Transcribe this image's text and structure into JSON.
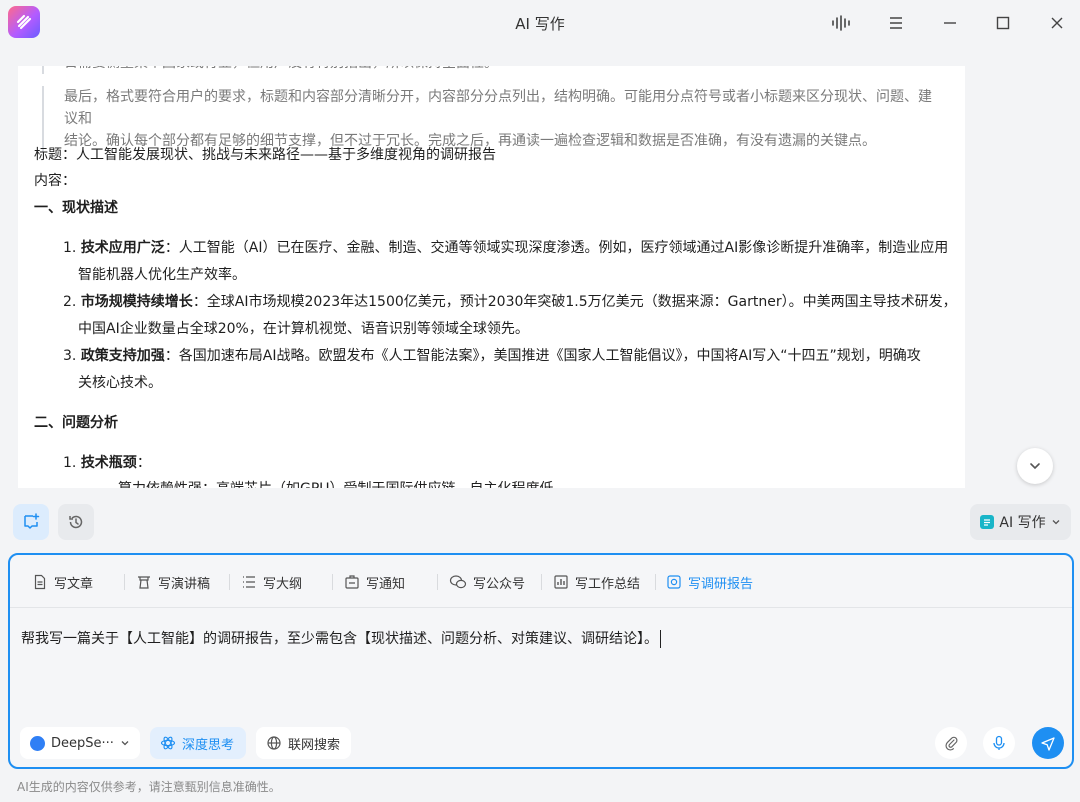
{
  "app": {
    "title": "AI 写作"
  },
  "doc": {
    "quote_partial": "日需要侧重某个国家或行业，但用户没有特别指出，所以保持全面性。",
    "quote_line1": "最后，格式要符合用户的要求，标题和内容部分清晰分开，内容部分分点列出，结构明确。可能用分点符号或者小标题来区分现状、问题、建议和",
    "quote_line2": "结论。确认每个部分都有足够的细节支撑，但不过于冗长。完成之后，再通读一遍检查逻辑和数据是否准确，有没有遗漏的关键点。",
    "title_line": "标题：人工智能发展现状、挑战与未来路径——基于多维度视角的调研报告",
    "content_label": "内容：",
    "section1": "一、现状描述",
    "items": [
      {
        "num": "1.",
        "bold": "技术应用广泛",
        "text1": "：人工智能（AI）已在医疗、金融、制造、交通等领域实现深度渗透。例如，医疗领域通过AI影像诊断提升准确率，制造业应用",
        "text2": "智能机器人优化生产效率。"
      },
      {
        "num": "2.",
        "bold": "市场规模持续增长",
        "text1": "：全球AI市场规模2023年达1500亿美元，预计2030年突破1.5万亿美元（数据来源：Gartner）。中美两国主导技术研发，",
        "text2": "中国AI企业数量占全球20%，在计算机视觉、语音识别等领域全球领先。"
      },
      {
        "num": "3.",
        "bold": "政策支持加强",
        "text1": "：各国加速布局AI战略。欧盟发布《人工智能法案》，美国推进《国家人工智能倡议》，中国将AI写入“十四五”规划，明确攻",
        "text2": "关核心技术。"
      }
    ],
    "section2": "二、问题分析",
    "item2_1_num": "1.",
    "item2_1_bold": "技术瓶颈",
    "item2_1_colon": "：",
    "item2_1_sub_partial": "算力依赖性强：高端芯片（如GPU）受制于国际供应链，自主化程度低。"
  },
  "toolbar": {
    "ai_mode_label": "AI 写作"
  },
  "composer": {
    "tabs": [
      "写文章",
      "写演讲稿",
      "写大纲",
      "写通知",
      "写公众号",
      "写工作总结",
      "写调研报告"
    ],
    "active_tab": "写调研报告",
    "prompt_text": "帮我写一篇关于【人工智能】的调研报告，至少需包含【现状描述、问题分析、对策建议、调研结论】。",
    "model_label": "DeepSe···",
    "deep_think_label": "深度思考",
    "web_search_label": "联网搜索"
  },
  "footer": {
    "disclaimer": "AI生成的内容仅供参考，请注意甄别信息准确性。"
  },
  "colors": {
    "accent": "#1e8ff2",
    "logo_gradient": [
      "#ff6a8a",
      "#b45cff",
      "#6a5cff"
    ]
  },
  "icons": [
    "app-logo-icon",
    "audio-wave-icon",
    "menu-icon",
    "minimize-icon",
    "maximize-icon",
    "close-icon",
    "chevron-down-icon",
    "new-chat-icon",
    "history-icon",
    "ai-write-icon",
    "document-icon",
    "podium-icon",
    "outline-icon",
    "notice-icon",
    "wechat-icon",
    "chart-icon",
    "report-icon",
    "deepseek-icon",
    "deep-think-icon",
    "globe-icon",
    "attachment-icon",
    "microphone-icon",
    "send-icon"
  ]
}
